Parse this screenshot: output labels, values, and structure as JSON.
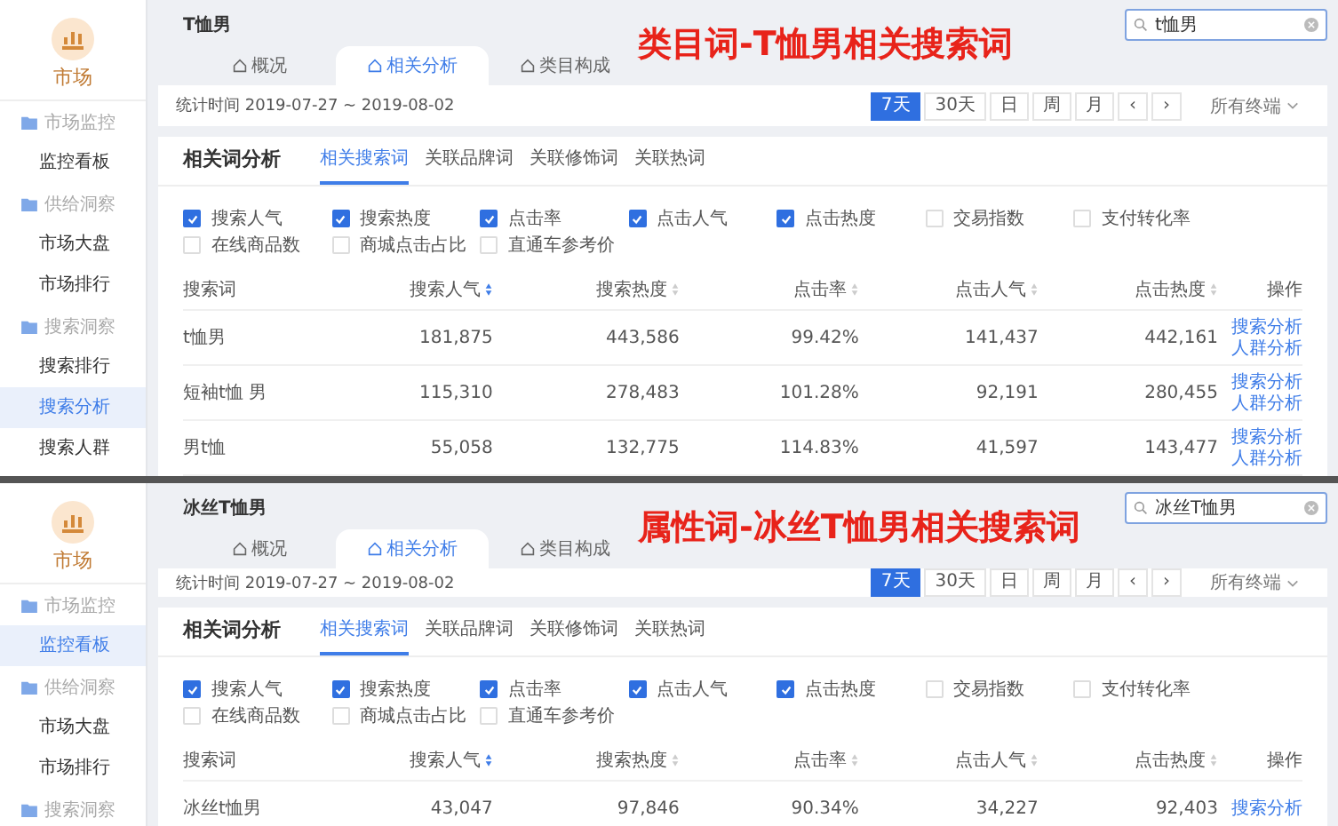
{
  "panels": [
    {
      "sidebar": {
        "logo_label": "市场",
        "groups": [
          {
            "label": "市场监控",
            "items": [
              {
                "label": "监控看板",
                "selected": false
              }
            ]
          },
          {
            "label": "供给洞察",
            "items": [
              {
                "label": "市场大盘",
                "selected": false
              },
              {
                "label": "市场排行",
                "selected": false
              }
            ]
          },
          {
            "label": "搜索洞察",
            "items": [
              {
                "label": "搜索排行",
                "selected": false
              },
              {
                "label": "搜索分析",
                "selected": true
              },
              {
                "label": "搜索人群",
                "selected": false
              }
            ]
          }
        ]
      },
      "title": "T恤男",
      "search": {
        "value": "t恤男"
      },
      "caption": "类目词-T恤男相关搜索词",
      "tabs": [
        {
          "label": "概况",
          "selected": false
        },
        {
          "label": "相关分析",
          "selected": true
        },
        {
          "label": "类目构成",
          "selected": false
        }
      ],
      "date_range": "统计时间 2019-07-27 ~ 2019-08-02",
      "date_buttons": [
        {
          "label": "7天",
          "selected": true
        },
        {
          "label": "30天",
          "selected": false
        },
        {
          "label": "日",
          "selected": false
        },
        {
          "label": "周",
          "selected": false
        },
        {
          "label": "月",
          "selected": false
        },
        {
          "label": "‹",
          "selected": false
        },
        {
          "label": "›",
          "selected": false
        }
      ],
      "terminal": "所有终端",
      "section_title": "相关词分析",
      "subtabs": [
        {
          "label": "相关搜索词",
          "selected": true
        },
        {
          "label": "关联品牌词",
          "selected": false
        },
        {
          "label": "关联修饰词",
          "selected": false
        },
        {
          "label": "关联热词",
          "selected": false
        }
      ],
      "metrics": [
        {
          "label": "搜索人气",
          "checked": true
        },
        {
          "label": "搜索热度",
          "checked": true
        },
        {
          "label": "点击率",
          "checked": true
        },
        {
          "label": "点击人气",
          "checked": true
        },
        {
          "label": "点击热度",
          "checked": true
        },
        {
          "label": "交易指数",
          "checked": false
        },
        {
          "label": "支付转化率",
          "checked": false
        },
        {
          "label": "在线商品数",
          "checked": false
        },
        {
          "label": "商城点击占比",
          "checked": false
        },
        {
          "label": "直通车参考价",
          "checked": false
        }
      ],
      "columns": [
        "搜索词",
        "搜索人气",
        "搜索热度",
        "点击率",
        "点击人气",
        "点击热度",
        "操作"
      ],
      "rows": [
        {
          "cells": [
            "t恤男",
            "181,875",
            "443,586",
            "99.42%",
            "141,437",
            "442,161"
          ],
          "actions": [
            "搜索分析",
            "人群分析"
          ]
        },
        {
          "cells": [
            "短袖t恤 男",
            "115,310",
            "278,483",
            "101.28%",
            "92,191",
            "280,455"
          ],
          "actions": [
            "搜索分析",
            "人群分析"
          ]
        },
        {
          "cells": [
            "男t恤",
            "55,058",
            "132,775",
            "114.83%",
            "41,597",
            "143,477"
          ],
          "actions": [
            "搜索分析",
            "人群分析"
          ]
        }
      ]
    },
    {
      "sidebar": {
        "logo_label": "市场",
        "groups": [
          {
            "label": "市场监控",
            "items": [
              {
                "label": "监控看板",
                "selected": true
              }
            ]
          },
          {
            "label": "供给洞察",
            "items": [
              {
                "label": "市场大盘",
                "selected": false
              },
              {
                "label": "市场排行",
                "selected": false
              }
            ]
          },
          {
            "label": "搜索洞察"
          }
        ]
      },
      "title": "冰丝T恤男",
      "search": {
        "value": "冰丝T恤男"
      },
      "caption": "属性词-冰丝T恤男相关搜索词",
      "tabs": [
        {
          "label": "概况",
          "selected": false
        },
        {
          "label": "相关分析",
          "selected": true
        },
        {
          "label": "类目构成",
          "selected": false
        }
      ],
      "date_range": "统计时间 2019-07-27 ~ 2019-08-02",
      "date_buttons": [
        {
          "label": "7天",
          "selected": true
        },
        {
          "label": "30天",
          "selected": false
        },
        {
          "label": "日",
          "selected": false
        },
        {
          "label": "周",
          "selected": false
        },
        {
          "label": "月",
          "selected": false
        },
        {
          "label": "‹",
          "selected": false
        },
        {
          "label": "›",
          "selected": false
        }
      ],
      "terminal": "所有终端",
      "section_title": "相关词分析",
      "subtabs": [
        {
          "label": "相关搜索词",
          "selected": true
        },
        {
          "label": "关联品牌词",
          "selected": false
        },
        {
          "label": "关联修饰词",
          "selected": false
        },
        {
          "label": "关联热词",
          "selected": false
        }
      ],
      "metrics": [
        {
          "label": "搜索人气",
          "checked": true
        },
        {
          "label": "搜索热度",
          "checked": true
        },
        {
          "label": "点击率",
          "checked": true
        },
        {
          "label": "点击人气",
          "checked": true
        },
        {
          "label": "点击热度",
          "checked": true
        },
        {
          "label": "交易指数",
          "checked": false
        },
        {
          "label": "支付转化率",
          "checked": false
        },
        {
          "label": "在线商品数",
          "checked": false
        },
        {
          "label": "商城点击占比",
          "checked": false
        },
        {
          "label": "直通车参考价",
          "checked": false
        }
      ],
      "columns": [
        "搜索词",
        "搜索人气",
        "搜索热度",
        "点击率",
        "点击人气",
        "点击热度",
        "操作"
      ],
      "rows": [
        {
          "cells": [
            "冰丝t恤男",
            "43,047",
            "97,846",
            "90.34%",
            "34,227",
            "92,403"
          ],
          "actions": [
            "搜索分析"
          ]
        }
      ]
    }
  ]
}
